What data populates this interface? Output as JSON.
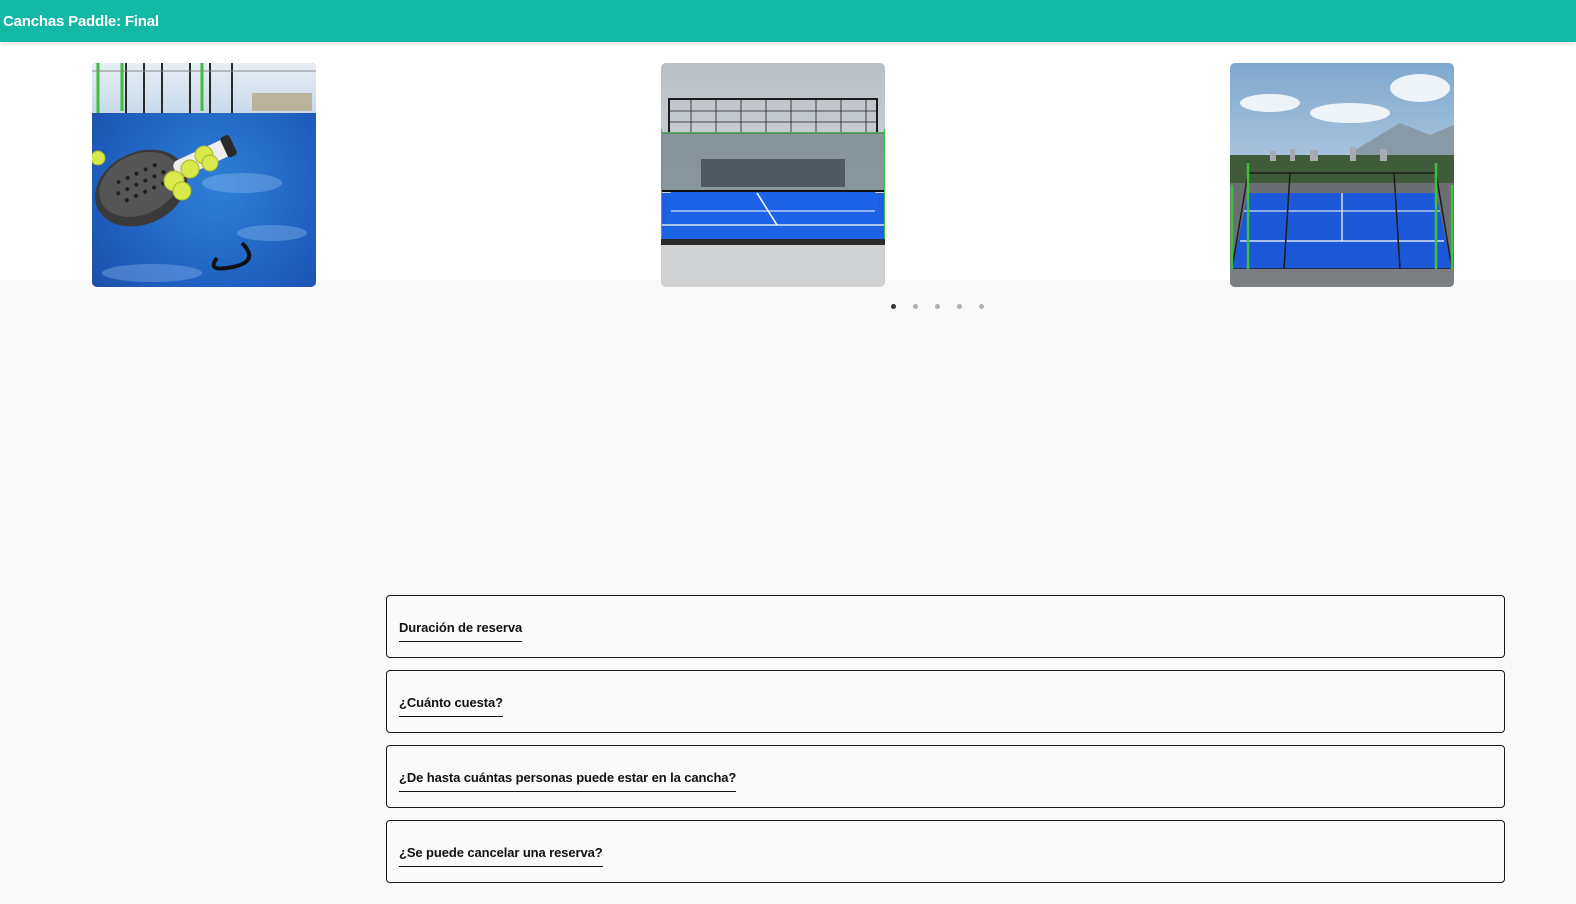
{
  "header": {
    "title": "Canchas Paddle: Final",
    "background_color": "#14b8a6"
  },
  "carousel": {
    "slides": [
      {
        "image": "padel racket and balls on blue court"
      },
      {
        "image": "blue padel court with glass walls and fence"
      },
      {
        "image": "rooftop blue padel court with city and mountains"
      }
    ],
    "pagination": {
      "total": 5,
      "active": 1
    }
  },
  "faq": {
    "items": [
      {
        "question": "Duración de reserva"
      },
      {
        "question": "¿Cuánto cuesta?"
      },
      {
        "question": "¿De hasta cuántas personas puede estar en la cancha?"
      },
      {
        "question": "¿Se puede cancelar una reserva?"
      }
    ]
  }
}
